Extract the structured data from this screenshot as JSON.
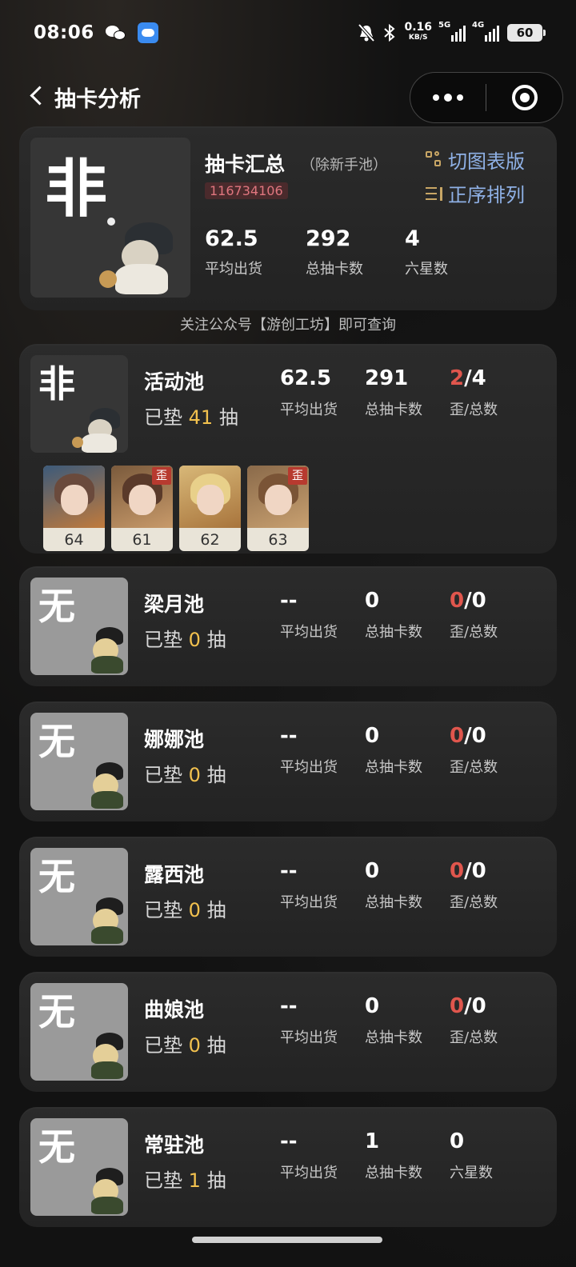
{
  "status_bar": {
    "time": "08:06",
    "net_speed": "0.16",
    "net_unit": "KB/S",
    "sim1": "5G",
    "sim2": "4G",
    "battery": "60"
  },
  "nav": {
    "title": "抽卡分析"
  },
  "summary": {
    "avatar_char": "非",
    "title": "抽卡汇总",
    "subtitle": "（除新手池）",
    "uid": "116734106",
    "switch_label": "切图表版",
    "sort_label": "正序排列",
    "stats": [
      {
        "value": "62.5",
        "label": "平均出货"
      },
      {
        "value": "292",
        "label": "总抽卡数"
      },
      {
        "value": "4",
        "label": "六星数"
      }
    ]
  },
  "notice": "关注公众号【游创工坊】即可查询",
  "pools": [
    {
      "avatar_char": "非",
      "name": "活动池",
      "pity_prefix": "已垫",
      "pity_count": "41",
      "pity_suffix": "抽",
      "avg": "62.5",
      "avg_label": "平均出货",
      "total": "291",
      "total_label": "总抽卡数",
      "off_count": "2",
      "off_total": "/4",
      "off_label": "歪/总数",
      "pulls": [
        {
          "count": "64",
          "off": false
        },
        {
          "count": "61",
          "off": true,
          "tag": "歪"
        },
        {
          "count": "62",
          "off": false
        },
        {
          "count": "63",
          "off": true,
          "tag": "歪"
        }
      ]
    },
    {
      "avatar_char": "无",
      "name": "梁月池",
      "pity_prefix": "已垫",
      "pity_count": "0",
      "pity_suffix": "抽",
      "avg": "--",
      "avg_label": "平均出货",
      "total": "0",
      "total_label": "总抽卡数",
      "off_count": "0",
      "off_total": "/0",
      "off_label": "歪/总数"
    },
    {
      "avatar_char": "无",
      "name": "娜娜池",
      "pity_prefix": "已垫",
      "pity_count": "0",
      "pity_suffix": "抽",
      "avg": "--",
      "avg_label": "平均出货",
      "total": "0",
      "total_label": "总抽卡数",
      "off_count": "0",
      "off_total": "/0",
      "off_label": "歪/总数"
    },
    {
      "avatar_char": "无",
      "name": "露西池",
      "pity_prefix": "已垫",
      "pity_count": "0",
      "pity_suffix": "抽",
      "avg": "--",
      "avg_label": "平均出货",
      "total": "0",
      "total_label": "总抽卡数",
      "off_count": "0",
      "off_total": "/0",
      "off_label": "歪/总数"
    },
    {
      "avatar_char": "无",
      "name": "曲娘池",
      "pity_prefix": "已垫",
      "pity_count": "0",
      "pity_suffix": "抽",
      "avg": "--",
      "avg_label": "平均出货",
      "total": "0",
      "total_label": "总抽卡数",
      "off_count": "0",
      "off_total": "/0",
      "off_label": "歪/总数"
    },
    {
      "avatar_char": "无",
      "name": "常驻池",
      "pity_prefix": "已垫",
      "pity_count": "1",
      "pity_suffix": "抽",
      "avg": "--",
      "avg_label": "平均出货",
      "total": "1",
      "total_label": "总抽卡数",
      "six_star": "0",
      "six_star_label": "六星数"
    }
  ],
  "colors": {
    "accent_blue": "#8fb1e6",
    "accent_gold": "#c8a665",
    "pity_yellow": "#f2c14e",
    "off_red": "#e0564d",
    "uid_bg": "#4a2a2c",
    "uid_text": "#e0767f"
  }
}
